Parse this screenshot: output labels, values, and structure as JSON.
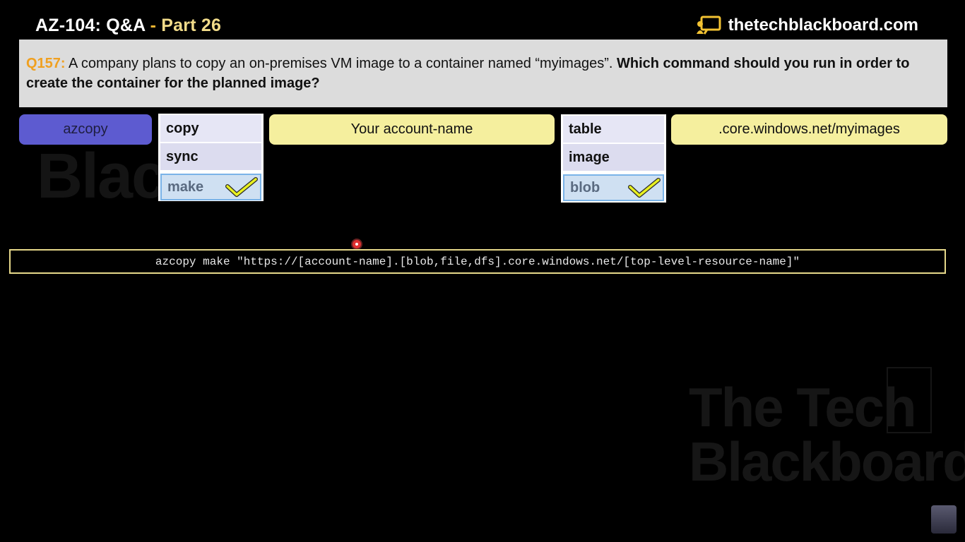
{
  "header": {
    "title_main": "AZ-104: Q&A",
    "title_sep": " - ",
    "title_part": "Part 26",
    "brand": "thetechblackboard.com"
  },
  "question": {
    "number": "Q157:",
    "text": " A company plans to copy an on-premises VM image to a container named “myimages”. ",
    "bold": "Which command should you run in order to create the container for the planned image?"
  },
  "answer_row": {
    "tool": "azcopy",
    "command_options": [
      "copy",
      "sync",
      "make"
    ],
    "account": "Your account-name",
    "service_options": [
      "table",
      "image",
      "blob"
    ],
    "domain": ".core.windows.net/myimages"
  },
  "command": "azcopy make \"https://[account-name].[blob,file,dfs].core.windows.net/[top-level-resource-name]\"",
  "watermark": {
    "line1": "Black",
    "line2": "The Tech",
    "line3": "Blackboard"
  },
  "colors": {
    "accent_orange": "#f0a020",
    "pill_yellow": "#f5ef9e",
    "pill_purple": "#5d5bd0",
    "check_yellow": "#e8f020"
  },
  "icons": {
    "brand": "chalkboard-icon",
    "selected": "checkmark-icon"
  }
}
